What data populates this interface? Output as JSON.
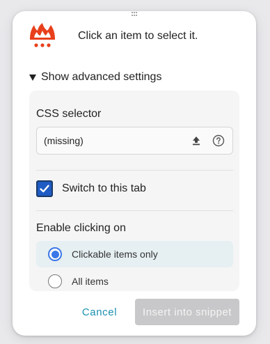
{
  "header": {
    "logo_icon": "flame-app-logo",
    "instruction": "Click an item to select it."
  },
  "advanced": {
    "toggle_label": "Show advanced settings",
    "expanded": true
  },
  "css_selector": {
    "label": "CSS selector",
    "value": "(missing)",
    "upload_icon": "upload-icon",
    "help_icon": "help-icon"
  },
  "switch_tab": {
    "label": "Switch to this tab",
    "checked": true
  },
  "enable_clicking": {
    "label": "Enable clicking on",
    "options": [
      {
        "label": "Clickable items only",
        "selected": true
      },
      {
        "label": "All items",
        "selected": false
      }
    ]
  },
  "actions": {
    "cancel_label": "Cancel",
    "insert_label": "Insert into snippet",
    "insert_enabled": false
  },
  "colors": {
    "accent_link": "#1a8fb0",
    "checkbox_fill": "#1f5bc4",
    "radio_selected": "#3b78e7",
    "logo_red": "#e8401c",
    "selected_row_bg": "#e6eff2",
    "disabled_button_bg": "#c8c8ca"
  }
}
